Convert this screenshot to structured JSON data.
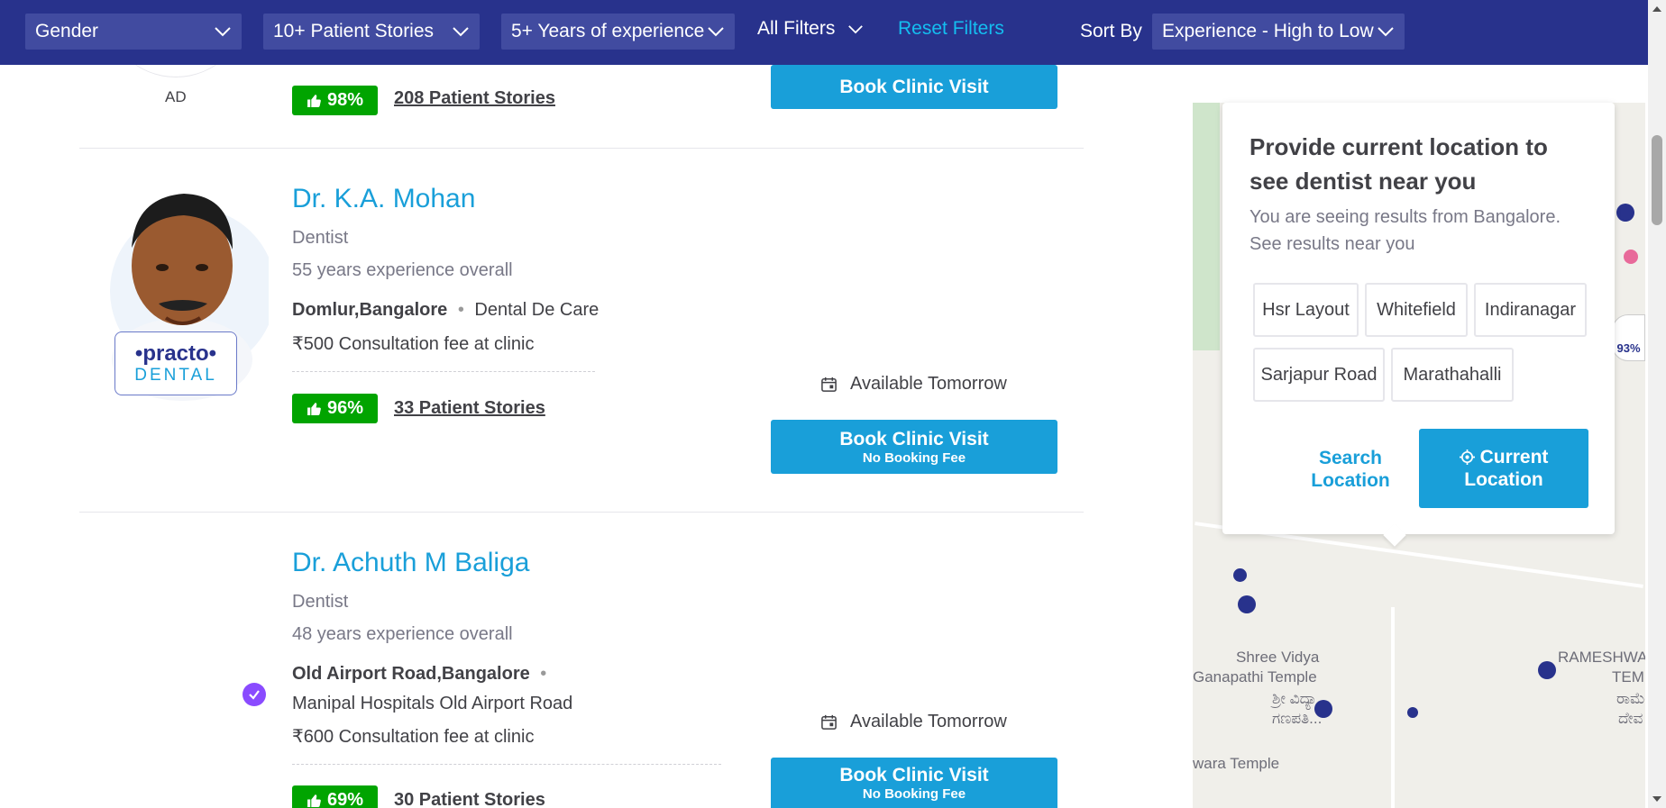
{
  "filters": {
    "gender": "Gender",
    "stories": "10+ Patient Stories",
    "experience": "5+ Years of experience",
    "all_filters": "All Filters",
    "reset": "Reset Filters",
    "sort_by_label": "Sort By",
    "sort_value": "Experience - High to Low"
  },
  "prev_card": {
    "ad_label": "AD",
    "rating": "98%",
    "stories": "208 Patient Stories",
    "book_label": "Book Clinic Visit"
  },
  "doctors": [
    {
      "name": "Dr. K.A. Mohan",
      "specialty": "Dentist",
      "experience": "55 years experience overall",
      "locality": "Domlur,Bangalore",
      "clinic": "Dental De Care",
      "fee": "₹500 Consultation fee at clinic",
      "rating": "96%",
      "stories": "33 Patient Stories",
      "availability": "Available Tomorrow",
      "book_label": "Book Clinic Visit",
      "book_sub": "No Booking Fee",
      "brand_top": "•practo•",
      "brand_bottom": "DENTAL"
    },
    {
      "name": "Dr. Achuth M Baliga",
      "specialty": "Dentist",
      "experience": "48 years experience overall",
      "locality": "Old Airport Road,Bangalore",
      "clinic": "Manipal Hospitals Old Airport Road",
      "fee": "₹600 Consultation fee at clinic",
      "rating": "69%",
      "stories": "30 Patient Stories",
      "availability": "Available Tomorrow",
      "book_label": "Book Clinic Visit",
      "book_sub": "No Booking Fee"
    }
  ],
  "location_popup": {
    "title": "Provide current location to see dentist near you",
    "subtitle": "You are seeing results from Bangalore. See results near you",
    "chips": [
      "Hsr Layout",
      "Whitefield",
      "Indiranagar",
      "Sarjapur Road",
      "Marathahalli"
    ],
    "search_line1": "Search",
    "search_line2": "Location",
    "current_line1": "Current",
    "current_line2": "Location"
  },
  "map": {
    "labels": [
      "Shree Vidya",
      "Ganapathi Temple",
      "ಶ್ರೀ ವಿದ್ಯಾ",
      "ಗಣಪತಿ...",
      "RAMESHWA",
      "TEM",
      "ರಾಮೇ",
      "ದೇವ",
      "wara Temple"
    ],
    "pin_rating": "93%"
  },
  "colors": {
    "nav_bg": "#28328c",
    "accent": "#199fd9",
    "rating_green": "#01a400",
    "reset_link": "#14bef0"
  }
}
